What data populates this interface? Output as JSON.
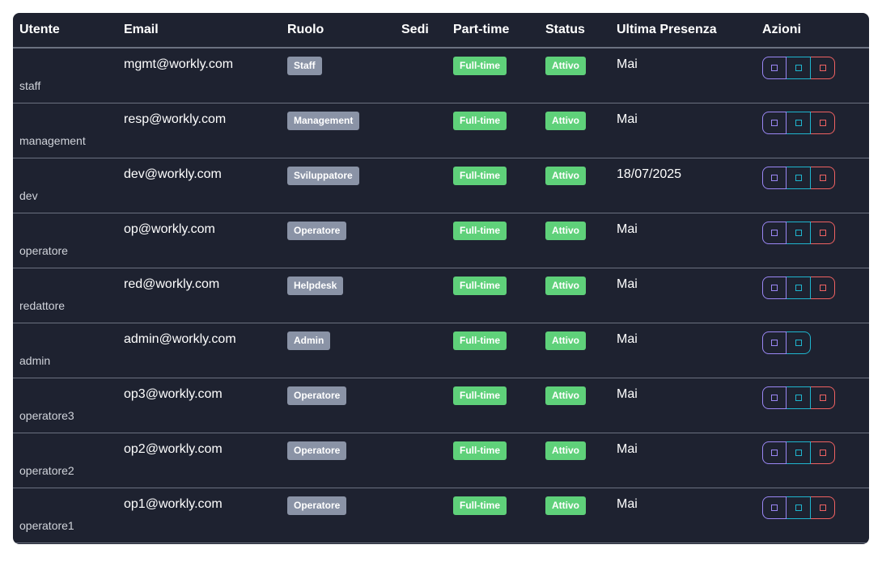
{
  "headers": {
    "utente": "Utente",
    "email": "Email",
    "ruolo": "Ruolo",
    "sedi": "Sedi",
    "part_time": "Part-time",
    "status": "Status",
    "ultima_presenza": "Ultima Presenza",
    "azioni": "Azioni"
  },
  "colors": {
    "role_badge": "#8a93a6",
    "green_badge": "#5fd17a",
    "edit_accent": "#9b87f5",
    "view_accent": "#1fb6cf",
    "delete_accent": "#f06262",
    "panel_bg": "#1e2230"
  },
  "icons": {
    "edit": "square-icon",
    "view": "square-icon",
    "delete": "square-icon"
  },
  "rows": [
    {
      "utente": "staff",
      "email": "mgmt@workly.com",
      "ruolo": "Staff",
      "sedi": "",
      "part_time": "Full-time",
      "status": "Attivo",
      "ultima_presenza": "Mai",
      "has_delete": true
    },
    {
      "utente": "management",
      "email": "resp@workly.com",
      "ruolo": "Management",
      "sedi": "",
      "part_time": "Full-time",
      "status": "Attivo",
      "ultima_presenza": "Mai",
      "has_delete": true
    },
    {
      "utente": "dev",
      "email": "dev@workly.com",
      "ruolo": "Sviluppatore",
      "sedi": "",
      "part_time": "Full-time",
      "status": "Attivo",
      "ultima_presenza": "18/07/2025",
      "has_delete": true
    },
    {
      "utente": "operatore",
      "email": "op@workly.com",
      "ruolo": "Operatore",
      "sedi": "",
      "part_time": "Full-time",
      "status": "Attivo",
      "ultima_presenza": "Mai",
      "has_delete": true
    },
    {
      "utente": "redattore",
      "email": "red@workly.com",
      "ruolo": "Helpdesk",
      "sedi": "",
      "part_time": "Full-time",
      "status": "Attivo",
      "ultima_presenza": "Mai",
      "has_delete": true
    },
    {
      "utente": "admin",
      "email": "admin@workly.com",
      "ruolo": "Admin",
      "sedi": "",
      "part_time": "Full-time",
      "status": "Attivo",
      "ultima_presenza": "Mai",
      "has_delete": false
    },
    {
      "utente": "operatore3",
      "email": "op3@workly.com",
      "ruolo": "Operatore",
      "sedi": "",
      "part_time": "Full-time",
      "status": "Attivo",
      "ultima_presenza": "Mai",
      "has_delete": true
    },
    {
      "utente": "operatore2",
      "email": "op2@workly.com",
      "ruolo": "Operatore",
      "sedi": "",
      "part_time": "Full-time",
      "status": "Attivo",
      "ultima_presenza": "Mai",
      "has_delete": true
    },
    {
      "utente": "operatore1",
      "email": "op1@workly.com",
      "ruolo": "Operatore",
      "sedi": "",
      "part_time": "Full-time",
      "status": "Attivo",
      "ultima_presenza": "Mai",
      "has_delete": true
    }
  ]
}
